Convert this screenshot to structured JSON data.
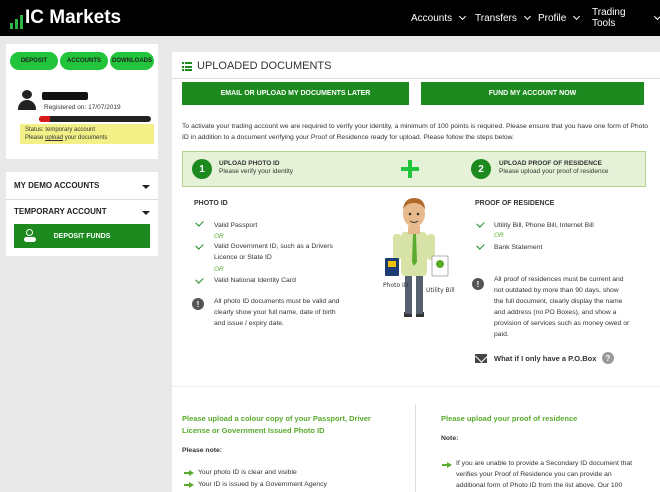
{
  "brand": {
    "name": "Markets",
    "prefix": "IC"
  },
  "nav": [
    {
      "label": "Accounts"
    },
    {
      "label": "Transfers"
    },
    {
      "label": "Profile"
    },
    {
      "label": "Trading Tools"
    }
  ],
  "sidebar": {
    "pills": [
      "DEPOSIT",
      "ACCOUNTS",
      "DOWNLOADS"
    ],
    "registered": "Registered on: 17/07/2019",
    "verification_progress": 0.1,
    "status_line": "Status: temporary account",
    "upload_prefix": "Please ",
    "upload_link": "upload",
    "upload_suffix": " your documents",
    "demo_accounts": "MY DEMO ACCOUNTS",
    "temporary_account": "TEMPORARY ACCOUNT",
    "deposit_funds": "DEPOSIT FUNDS"
  },
  "main": {
    "title": "UPLOADED DOCUMENTS",
    "email_button": "EMAIL OR UPLOAD MY DOCUMENTS LATER",
    "fund_button": "FUND MY ACCOUNT NOW",
    "intro": "To activate your trading account we are required to verify your identity, a minimum of 100 points is required. Please ensure that you have one form of Photo ID in addition to a document verifying your Proof of Residence ready for upload. Please follow the steps below.",
    "step1": {
      "num": "1",
      "title": "UPLOAD PHOTO ID",
      "sub": "Please verify your identity"
    },
    "step2": {
      "num": "2",
      "title": "UPLOAD PROOF OF RESIDENCE",
      "sub": "Please upload your proof of residence"
    },
    "photo_id": {
      "heading": "PHOTO ID",
      "item1": "Valid Passport",
      "or1": "OR",
      "item2a": "Valid Government ID, such as a Drivers",
      "item2b": "Licence or State ID",
      "or2": "OR",
      "item3": "Valid National Identity Card",
      "warn_a": "All photo ID documents must be valid and",
      "warn_b": "clearly show your full name, date of birth",
      "warn_c": "and issue / expiry date."
    },
    "proof": {
      "heading": "PROOF OF RESIDENCE",
      "item1": "Utility Bill, Phone Bill, Internet Bill",
      "or1": "OR",
      "item2": "Bank Statement",
      "warn_a": "All proof of residences must be current and",
      "warn_b": "not outdated by more than 90 days, show",
      "warn_c": "the full document, clearly display the name",
      "warn_d": "and address (no PO Boxes), and show a",
      "warn_e": "provision of services such as money owed or",
      "warn_f": "paid.",
      "pobox": "What if I only have a P.O.Box"
    },
    "illustration": {
      "card_label": "Photo ID",
      "bill_label": "Utility Bill"
    },
    "bottom_left": {
      "heading_a": "Please upload a colour copy of your Passport, Driver",
      "heading_b": "License or Government Issued Photo ID",
      "note": "Please note:",
      "item1": "Your photo ID is clear and visible",
      "item2": "Your ID is issued by a Government Agency"
    },
    "bottom_right": {
      "heading": "Please upload your proof of residence",
      "note": "Note:",
      "item_a": "If you are unable to provide a Secondary ID document that",
      "item_b": "verifies your Proof of Residence you can provide an",
      "item_c": "additional form of Photo ID from the list above. Our 100"
    }
  },
  "colors": {
    "brand_green": "#1c8a1e",
    "pill_green": "#21c43b",
    "accent_text": "#5aaa2e",
    "status_yellow": "#f2f086",
    "progress_red": "#d51a1a"
  }
}
